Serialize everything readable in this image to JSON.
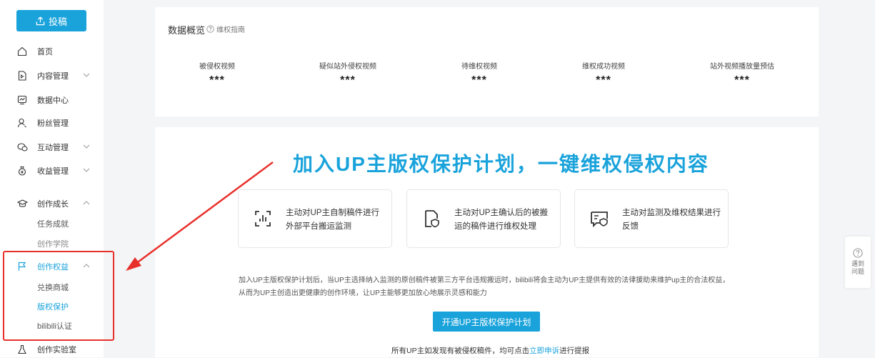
{
  "sidebar": {
    "post_label": "投稿",
    "items": {
      "home": "首页",
      "content": "内容管理",
      "data": "数据中心",
      "fans": "粉丝管理",
      "interaction": "互动管理",
      "income": "收益管理",
      "growth": "创作成长",
      "growth_tasks": "任务成就",
      "growth_academy": "创作学院",
      "rights": "创作权益",
      "rights_shop": "兑换商城",
      "rights_copyright": "版权保护",
      "rights_cert": "bilibili认证",
      "lab": "创作实验室"
    },
    "colors": {
      "accent": "#1aa3db",
      "highlight": "#e8302b"
    }
  },
  "overview": {
    "title": "数据概览",
    "guide": "维权指南",
    "stats": [
      {
        "label": "被侵权视频",
        "value": "***"
      },
      {
        "label": "疑似站外侵权视频",
        "value": "***"
      },
      {
        "label": "待维权视频",
        "value": "***"
      },
      {
        "label": "维权成功视频",
        "value": "***"
      },
      {
        "label": "站外视频播放量预估",
        "value": "***"
      }
    ]
  },
  "main": {
    "headline": "加入UP主版权保护计划，一键维权侵权内容",
    "features": [
      {
        "text": "主动对UP主自制稿件进行外部平台搬运监测",
        "icon": "chart-monitor-icon"
      },
      {
        "text": "主动对UP主确认后的被搬运的稿件进行维权处理",
        "icon": "file-shield-icon"
      },
      {
        "text": "主动对监测及维权结果进行反馈",
        "icon": "message-shield-icon"
      }
    ],
    "description": "加入UP主版权保护计划后，当UP主选择纳入监测的原创稿件被第三方平台违规搬运时，bilibili将会主动为UP主提供有效的法律援助来维护up主的合法权益，从而为UP主创造出更健康的创作环境，让UP主能够更加放心地展示灵感和能力",
    "join_button": "开通UP主版权保护计划",
    "footer_prefix": "所有UP主如发现有被侵权稿件，均可点击",
    "footer_link": "立即申诉",
    "footer_suffix": "进行提报"
  },
  "help": {
    "label": "遇到问题"
  }
}
